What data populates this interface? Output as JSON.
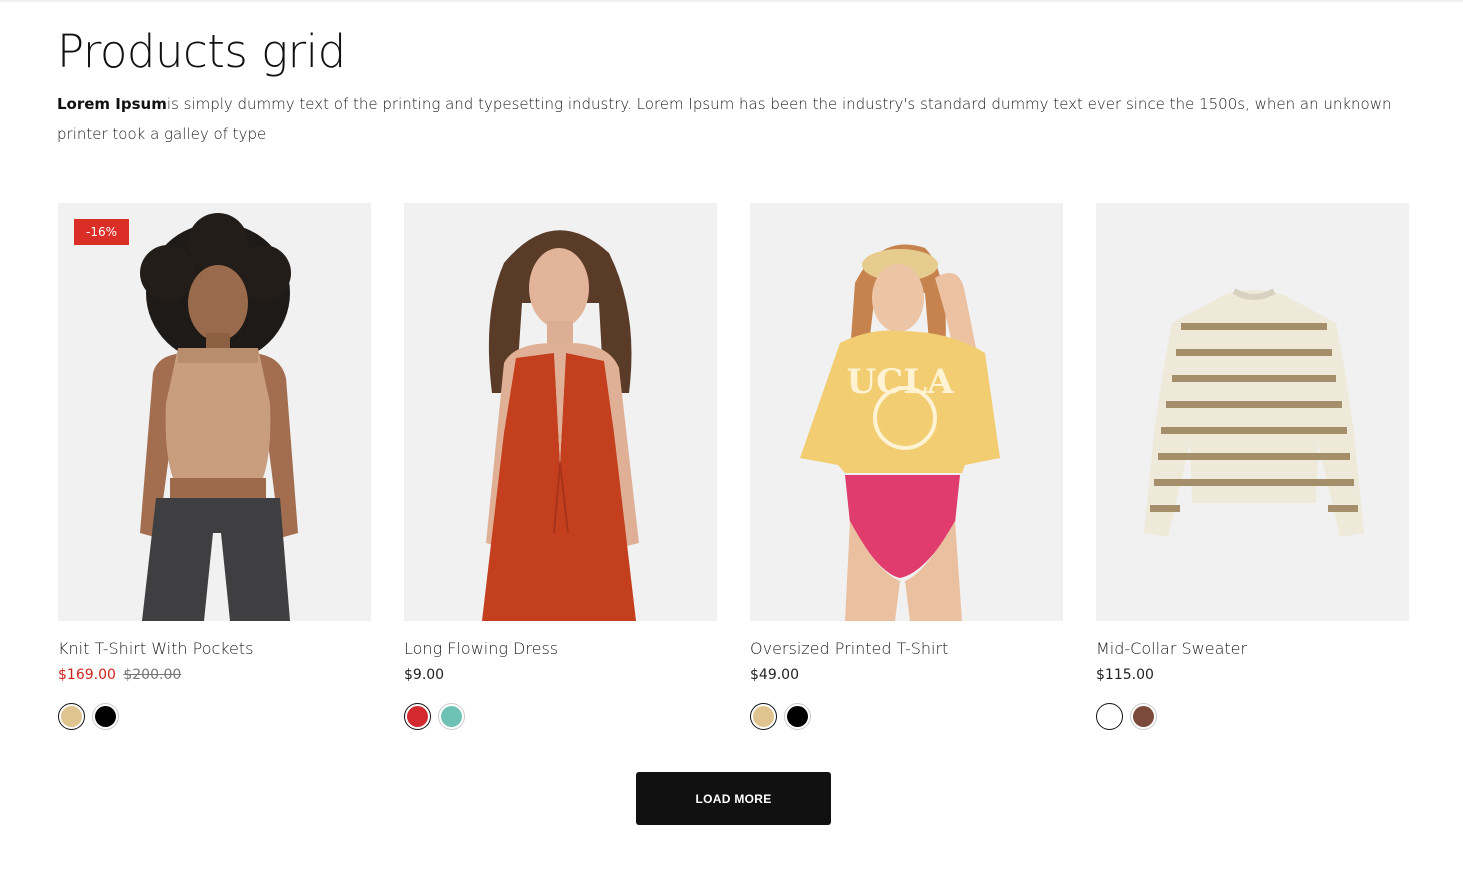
{
  "page": {
    "title": "Products grid",
    "description_bold": "Lorem Ipsum",
    "description_rest": "is simply dummy text of the printing and typesetting industry. Lorem Ipsum has been the industry's standard dummy text ever since the 1500s, when an unknown printer took a galley of type"
  },
  "products": [
    {
      "name": "Knit T-Shirt With Pockets",
      "badge": "-16%",
      "price": "$169.00",
      "old_price": "$200.00",
      "swatches": [
        {
          "color": "#e0c48f",
          "active": true
        },
        {
          "color": "#000000",
          "active": false
        }
      ]
    },
    {
      "name": "Long Flowing Dress",
      "price": "$9.00",
      "swatches": [
        {
          "color": "#d22a2f",
          "active": true
        },
        {
          "color": "#6fc1b5",
          "active": false
        }
      ]
    },
    {
      "name": "Oversized Printed T-Shirt",
      "price": "$49.00",
      "swatches": [
        {
          "color": "#e0c48f",
          "active": true
        },
        {
          "color": "#000000",
          "active": false
        }
      ]
    },
    {
      "name": "Mid-Collar Sweater",
      "price": "$115.00",
      "swatches": [
        {
          "color": "#ffffff",
          "active": true
        },
        {
          "color": "#7b4a3a",
          "active": false
        }
      ]
    }
  ],
  "load_more": {
    "label": "LOAD MORE"
  }
}
